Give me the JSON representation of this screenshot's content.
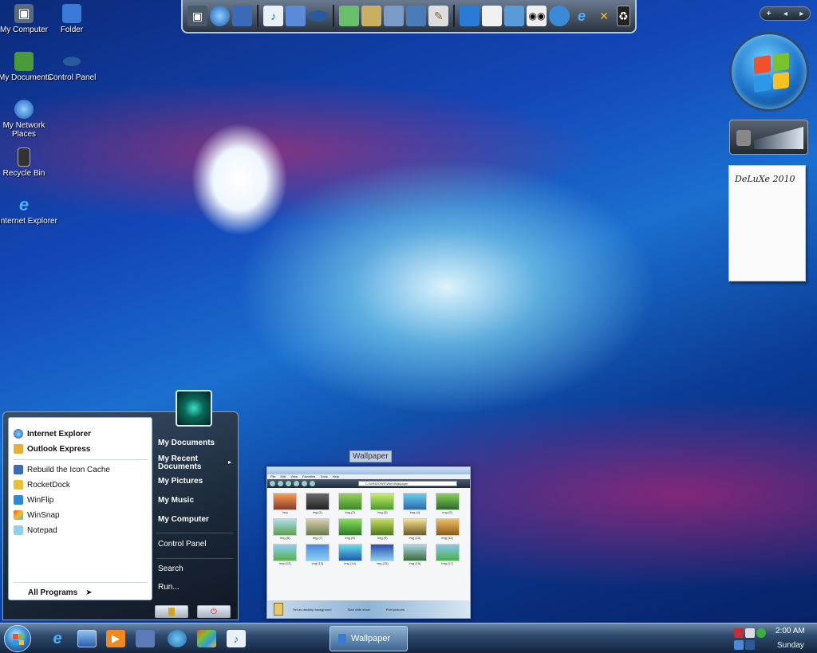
{
  "desktop": {
    "icons": [
      {
        "label": "My Computer"
      },
      {
        "label": "Folder"
      },
      {
        "label": "My Documents"
      },
      {
        "label": "Control Panel"
      },
      {
        "label": "My Network Places"
      },
      {
        "label": "Recycle Bin"
      },
      {
        "label": "Internet Explorer"
      }
    ]
  },
  "gadgets": {
    "notes_text": "DeLuXe 2010",
    "sidebar_plus": "+",
    "sidebar_prev": "◂",
    "sidebar_next": "▸"
  },
  "start_menu": {
    "pinned": [
      {
        "label": "Internet Explorer"
      },
      {
        "label": "Outlook Express"
      }
    ],
    "recent": [
      {
        "label": "Rebuild the Icon Cache"
      },
      {
        "label": "RocketDock"
      },
      {
        "label": "WinFlip"
      },
      {
        "label": "WinSnap"
      },
      {
        "label": "Notepad"
      }
    ],
    "all_programs": "All Programs",
    "right": {
      "my_documents": "My Documents",
      "my_recent_documents": "My Recent Documents",
      "my_pictures": "My Pictures",
      "my_music": "My Music",
      "my_computer": "My Computer",
      "control_panel": "Control Panel",
      "search": "Search",
      "run": "Run..."
    }
  },
  "preview": {
    "tooltip": "Wallpaper",
    "menus": [
      "File",
      "Edit",
      "View",
      "Favorites",
      "Tools",
      "Help"
    ],
    "address": "C:\\WINDOWS\\Web\\Wallpaper",
    "items": [
      "img",
      "img (1)",
      "img (2)",
      "img (3)",
      "img (4)",
      "img (5)",
      "img (6)",
      "img (7)",
      "img (8)",
      "img (9)",
      "img (10)",
      "img (11)",
      "img (12)",
      "img (13)",
      "img (14)",
      "img (15)",
      "img (16)",
      "img (17)"
    ],
    "status_left": "Set as desktop background",
    "status_mid": "Start slide show",
    "status_right": "Print pictures"
  },
  "taskbar": {
    "active_window": "Wallpaper",
    "clock_time": "2:00 AM",
    "clock_day": "Sunday"
  },
  "colors": {
    "wallpaper_deep": "#0b2a7a",
    "wallpaper_bright": "#1a6fcf",
    "accent_magenta": "#e01e6e",
    "start_menu_bg": "#1b2838"
  }
}
